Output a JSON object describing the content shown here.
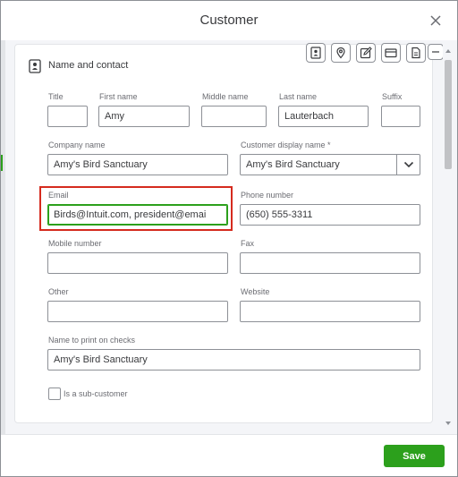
{
  "window": {
    "title": "Customer"
  },
  "section": {
    "title": "Name and contact"
  },
  "toolbar": {
    "icons": [
      "contact-card-icon",
      "location-pin-icon",
      "edit-note-icon",
      "payment-card-icon",
      "document-icon",
      "collapse-icon"
    ]
  },
  "fields": {
    "title": {
      "label": "Title",
      "value": ""
    },
    "first_name": {
      "label": "First name",
      "value": "Amy"
    },
    "middle_name": {
      "label": "Middle name",
      "value": ""
    },
    "last_name": {
      "label": "Last name",
      "value": "Lauterbach"
    },
    "suffix": {
      "label": "Suffix",
      "value": ""
    },
    "company_name": {
      "label": "Company name",
      "value": "Amy's Bird Sanctuary"
    },
    "display_name": {
      "label": "Customer display name *",
      "value": "Amy's Bird Sanctuary"
    },
    "email": {
      "label": "Email",
      "value": "Birds@Intuit.com, president@emai"
    },
    "phone": {
      "label": "Phone number",
      "value": "(650) 555-3311"
    },
    "mobile": {
      "label": "Mobile number",
      "value": ""
    },
    "fax": {
      "label": "Fax",
      "value": ""
    },
    "other": {
      "label": "Other",
      "value": ""
    },
    "website": {
      "label": "Website",
      "value": ""
    },
    "print_name": {
      "label": "Name to print on checks",
      "value": "Amy's Bird Sanctuary"
    }
  },
  "sub_customer": {
    "label": "Is a sub-customer",
    "checked": false
  },
  "footer": {
    "save_label": "Save"
  },
  "colors": {
    "accent": "#2ca01c",
    "highlight": "#d52b1e",
    "border": "#8d9096"
  }
}
